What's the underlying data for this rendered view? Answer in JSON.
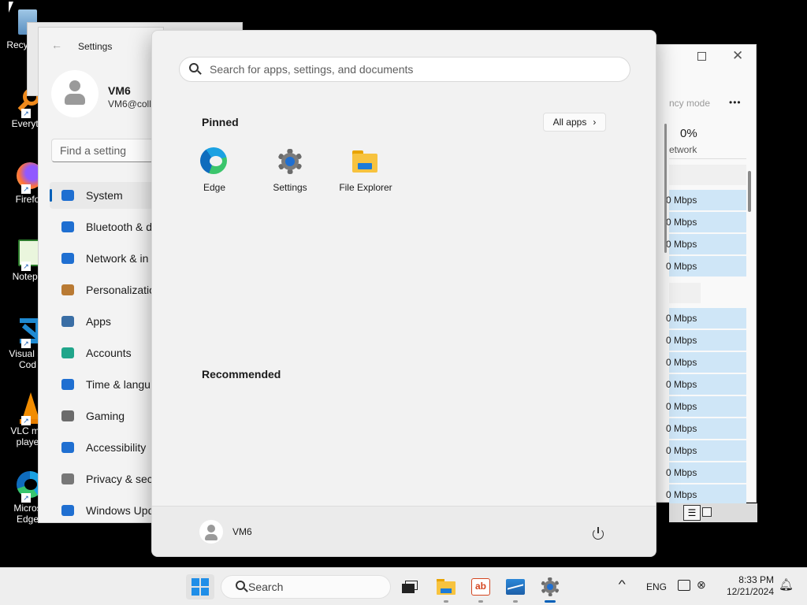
{
  "desktop": {
    "icons": [
      {
        "label": "Recy",
        "icon": "recycle-bin-icon"
      },
      {
        "label": "Everyth",
        "icon": "everything-search-icon"
      },
      {
        "label": "Firefo",
        "icon": "firefox-icon"
      },
      {
        "label": "Notepa",
        "icon": "notepad-icon"
      },
      {
        "label": "Visual St\nCod",
        "icon": "vscode-icon"
      },
      {
        "label": "VLC me\nplaye",
        "icon": "vlc-icon"
      },
      {
        "label": "Micros\nEdge",
        "icon": "edge-icon"
      }
    ]
  },
  "settings_window": {
    "title": "Settings",
    "user_name": "VM6",
    "user_email": "VM6@coll",
    "find_placeholder": "Find a setting",
    "nav": [
      {
        "label": "System",
        "icon": "system-icon"
      },
      {
        "label": "Bluetooth & d",
        "icon": "bluetooth-icon"
      },
      {
        "label": "Network & in",
        "icon": "wifi-icon"
      },
      {
        "label": "Personalizatio",
        "icon": "brush-icon"
      },
      {
        "label": "Apps",
        "icon": "apps-icon"
      },
      {
        "label": "Accounts",
        "icon": "accounts-icon"
      },
      {
        "label": "Time & langu",
        "icon": "time-language-icon"
      },
      {
        "label": "Gaming",
        "icon": "gamepad-icon"
      },
      {
        "label": "Accessibility",
        "icon": "accessibility-icon"
      },
      {
        "label": "Privacy & secu",
        "icon": "shield-icon"
      },
      {
        "label": "Windows Upd",
        "icon": "update-icon"
      }
    ]
  },
  "task_manager": {
    "mode_text": "ncy mode",
    "more": "•••",
    "network_pct": "0%",
    "network_label": "etwork",
    "rows": [
      "0 Mbps",
      "0 Mbps",
      "0 Mbps",
      "0 Mbps",
      "0 Mbps",
      "0 Mbps",
      "0 Mbps",
      "0 Mbps",
      "0 Mbps",
      "0 Mbps",
      "0 Mbps",
      "0 Mbps",
      "0 Mbps"
    ]
  },
  "start_menu": {
    "search_placeholder": "Search for apps, settings, and documents",
    "pinned_label": "Pinned",
    "all_apps_label": "All apps",
    "pinned": [
      {
        "label": "Edge",
        "icon": "edge-icon"
      },
      {
        "label": "Settings",
        "icon": "settings-gear-icon"
      },
      {
        "label": "File Explorer",
        "icon": "folder-icon"
      }
    ],
    "recommended_label": "Recommended",
    "user_name": "VM6"
  },
  "taskbar": {
    "search_label": "Search",
    "language": "ENG",
    "time": "8:33 PM",
    "date": "12/21/2024"
  },
  "colors": {
    "accent": "#005fb8",
    "selection": "#cfe6f7",
    "start_bg": "#f2f2f2"
  }
}
